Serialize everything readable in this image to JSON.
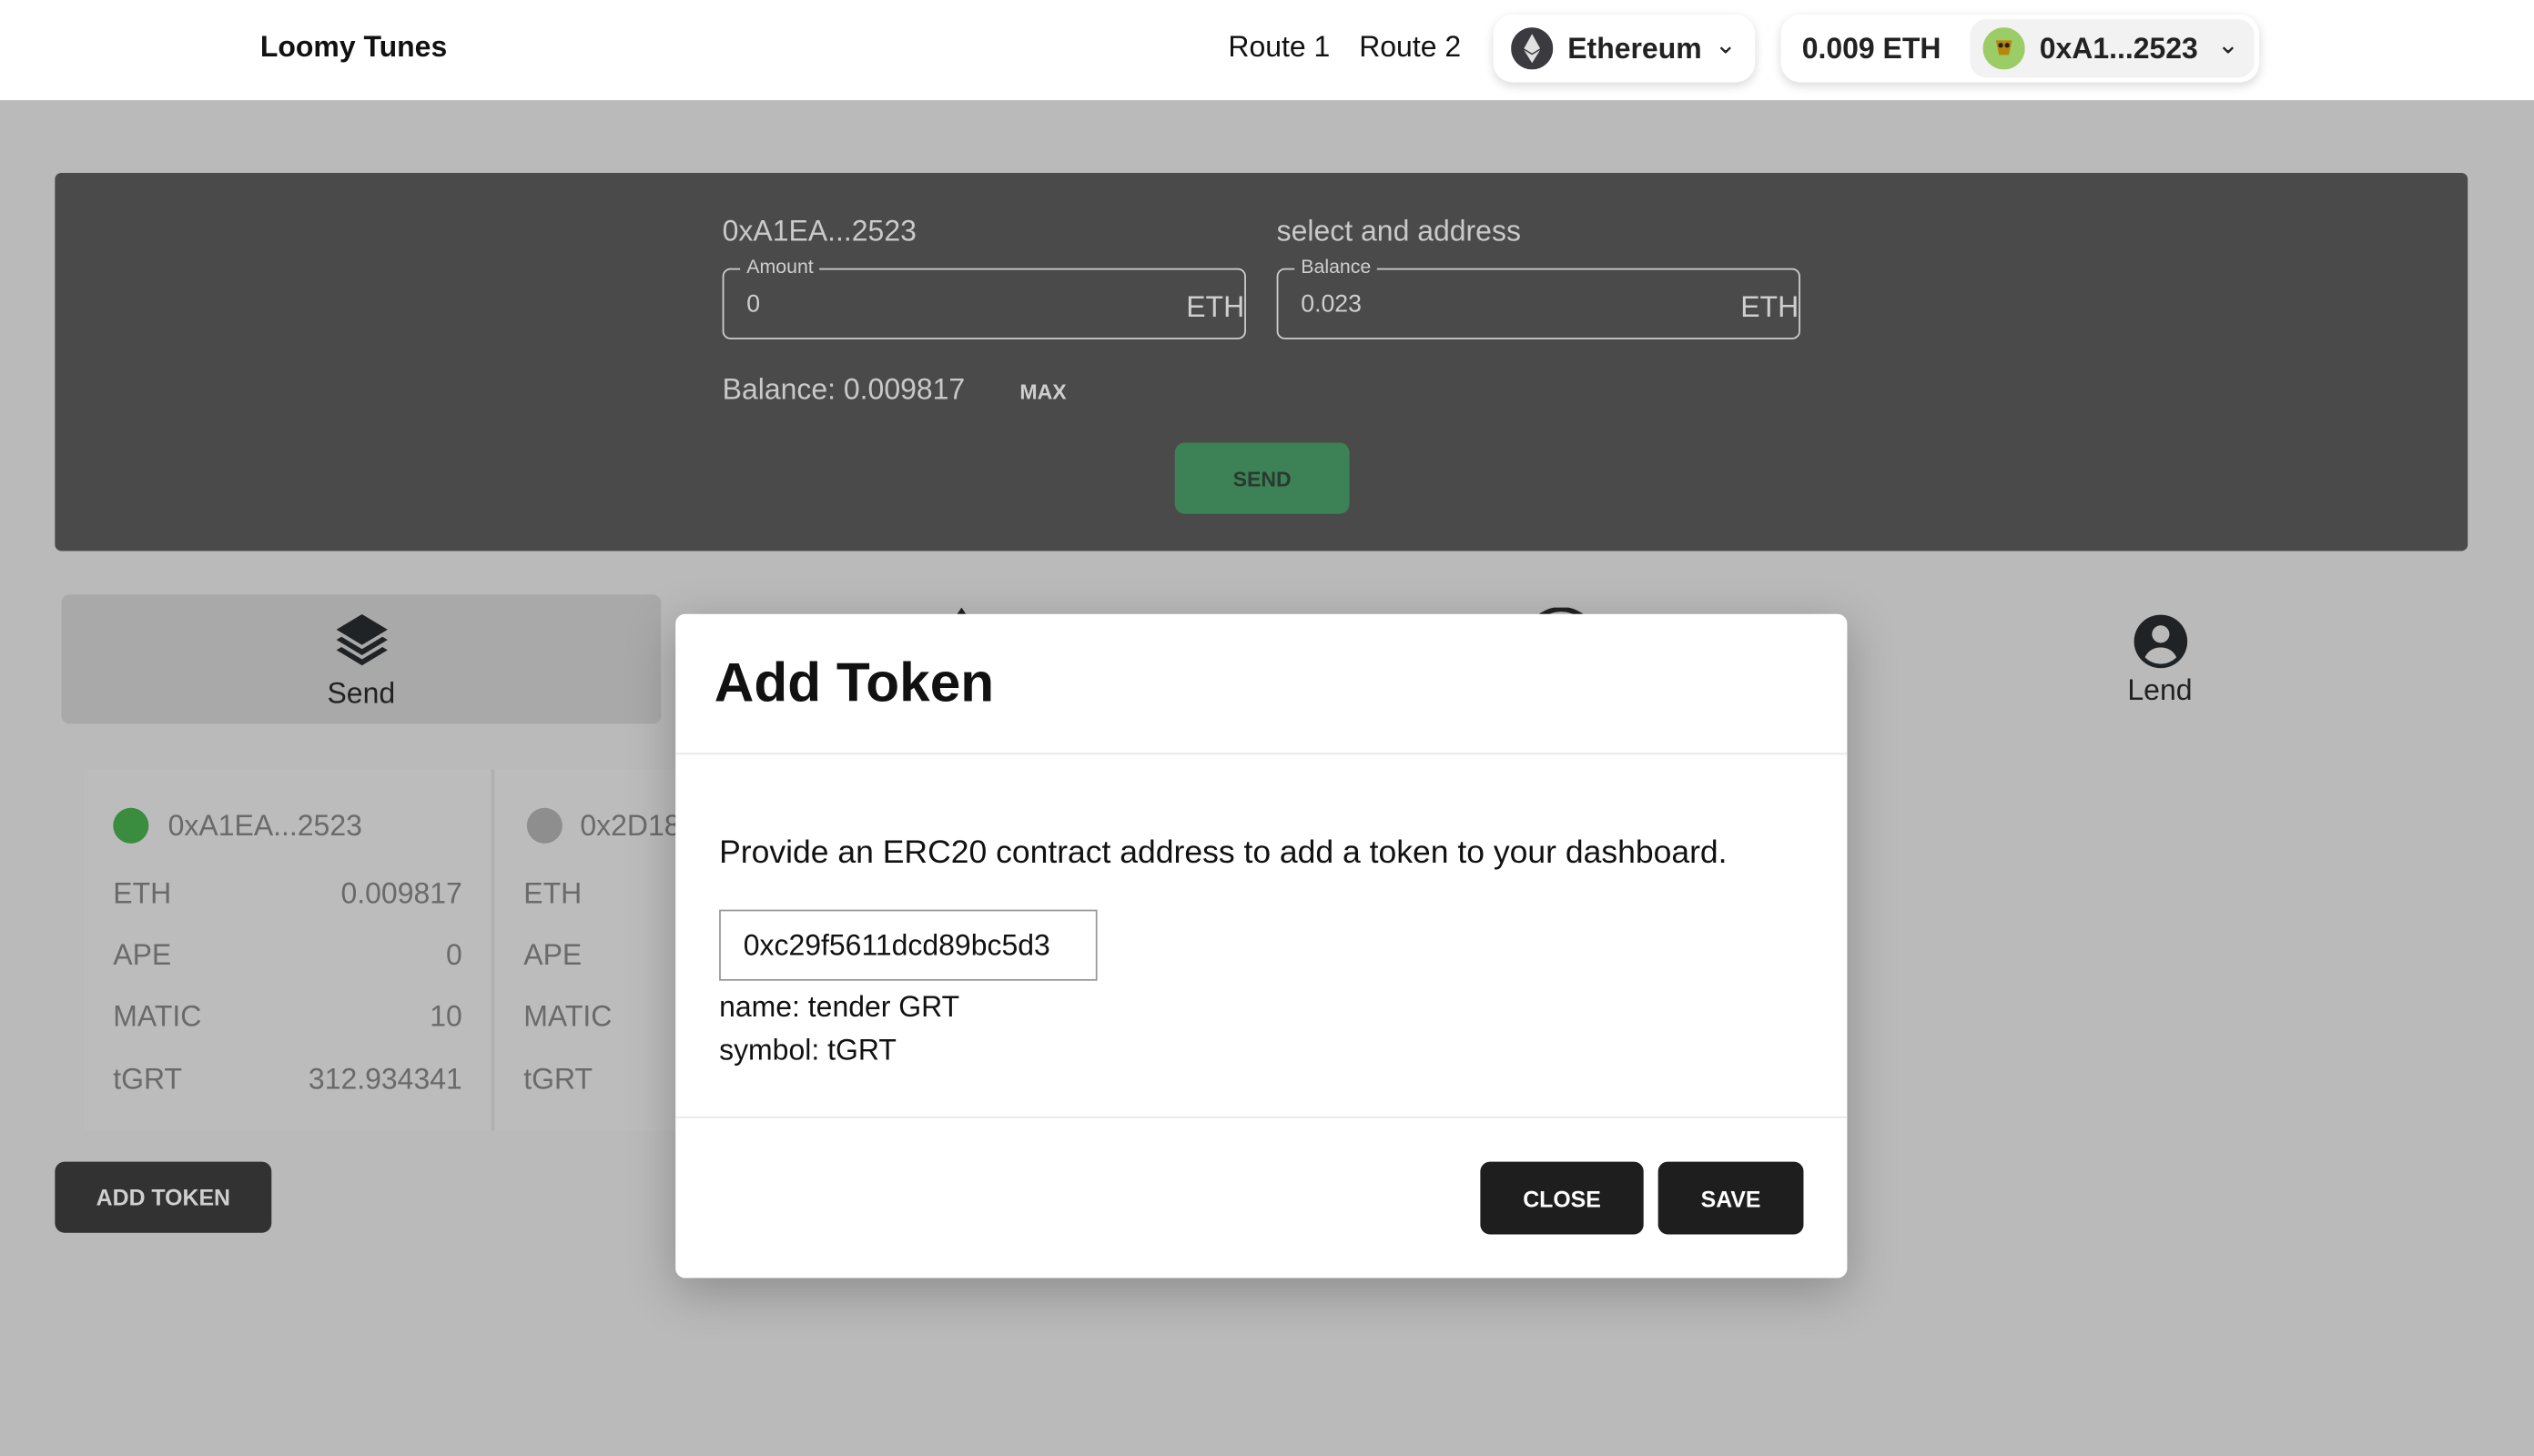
{
  "header": {
    "brand": "Loomy Tunes",
    "routes": [
      "Route 1",
      "Route 2"
    ],
    "network": "Ethereum",
    "balance": "0.009 ETH",
    "account": "0xA1...2523"
  },
  "send_panel": {
    "from_address": "0xA1EA...2523",
    "to_label": "select and address",
    "amount": {
      "label": "Amount",
      "value": "0",
      "unit": "ETH"
    },
    "balance_field": {
      "label": "Balance",
      "value": "0.023",
      "unit": "ETH"
    },
    "balance_text": "Balance: 0.009817",
    "max_label": "MAX",
    "send_label": "SEND",
    "send_color": "#3d8256"
  },
  "tabs": [
    {
      "label": "Send",
      "icon": "layers-icon",
      "active": true
    },
    {
      "label": "",
      "icon": "unknown-icon"
    },
    {
      "label": "",
      "icon": "unknown-icon"
    },
    {
      "label": "Lend",
      "icon": "user-circle-icon"
    }
  ],
  "wallets": [
    {
      "address": "0xA1EA...2523",
      "status_color": "#3a8c3f",
      "tokens": [
        {
          "symbol": "ETH",
          "amount": "0.009817"
        },
        {
          "symbol": "APE",
          "amount": "0"
        },
        {
          "symbol": "MATIC",
          "amount": "10"
        },
        {
          "symbol": "tGRT",
          "amount": "312.934341"
        }
      ]
    },
    {
      "address": "0x2D18",
      "status_color": "#8e8e8e",
      "tokens": [
        {
          "symbol": "ETH"
        },
        {
          "symbol": "APE"
        },
        {
          "symbol": "MATIC"
        },
        {
          "symbol": "tGRT"
        }
      ]
    }
  ],
  "add_token_label": "ADD TOKEN",
  "modal": {
    "title": "Add Token",
    "description": "Provide an ERC20 contract address to add a token to your dashboard.",
    "address_value": "0xc29f5611dcd89bc5d3",
    "name_text": "name: tender GRT",
    "symbol_text": "symbol: tGRT",
    "close_label": "CLOSE",
    "save_label": "SAVE"
  }
}
